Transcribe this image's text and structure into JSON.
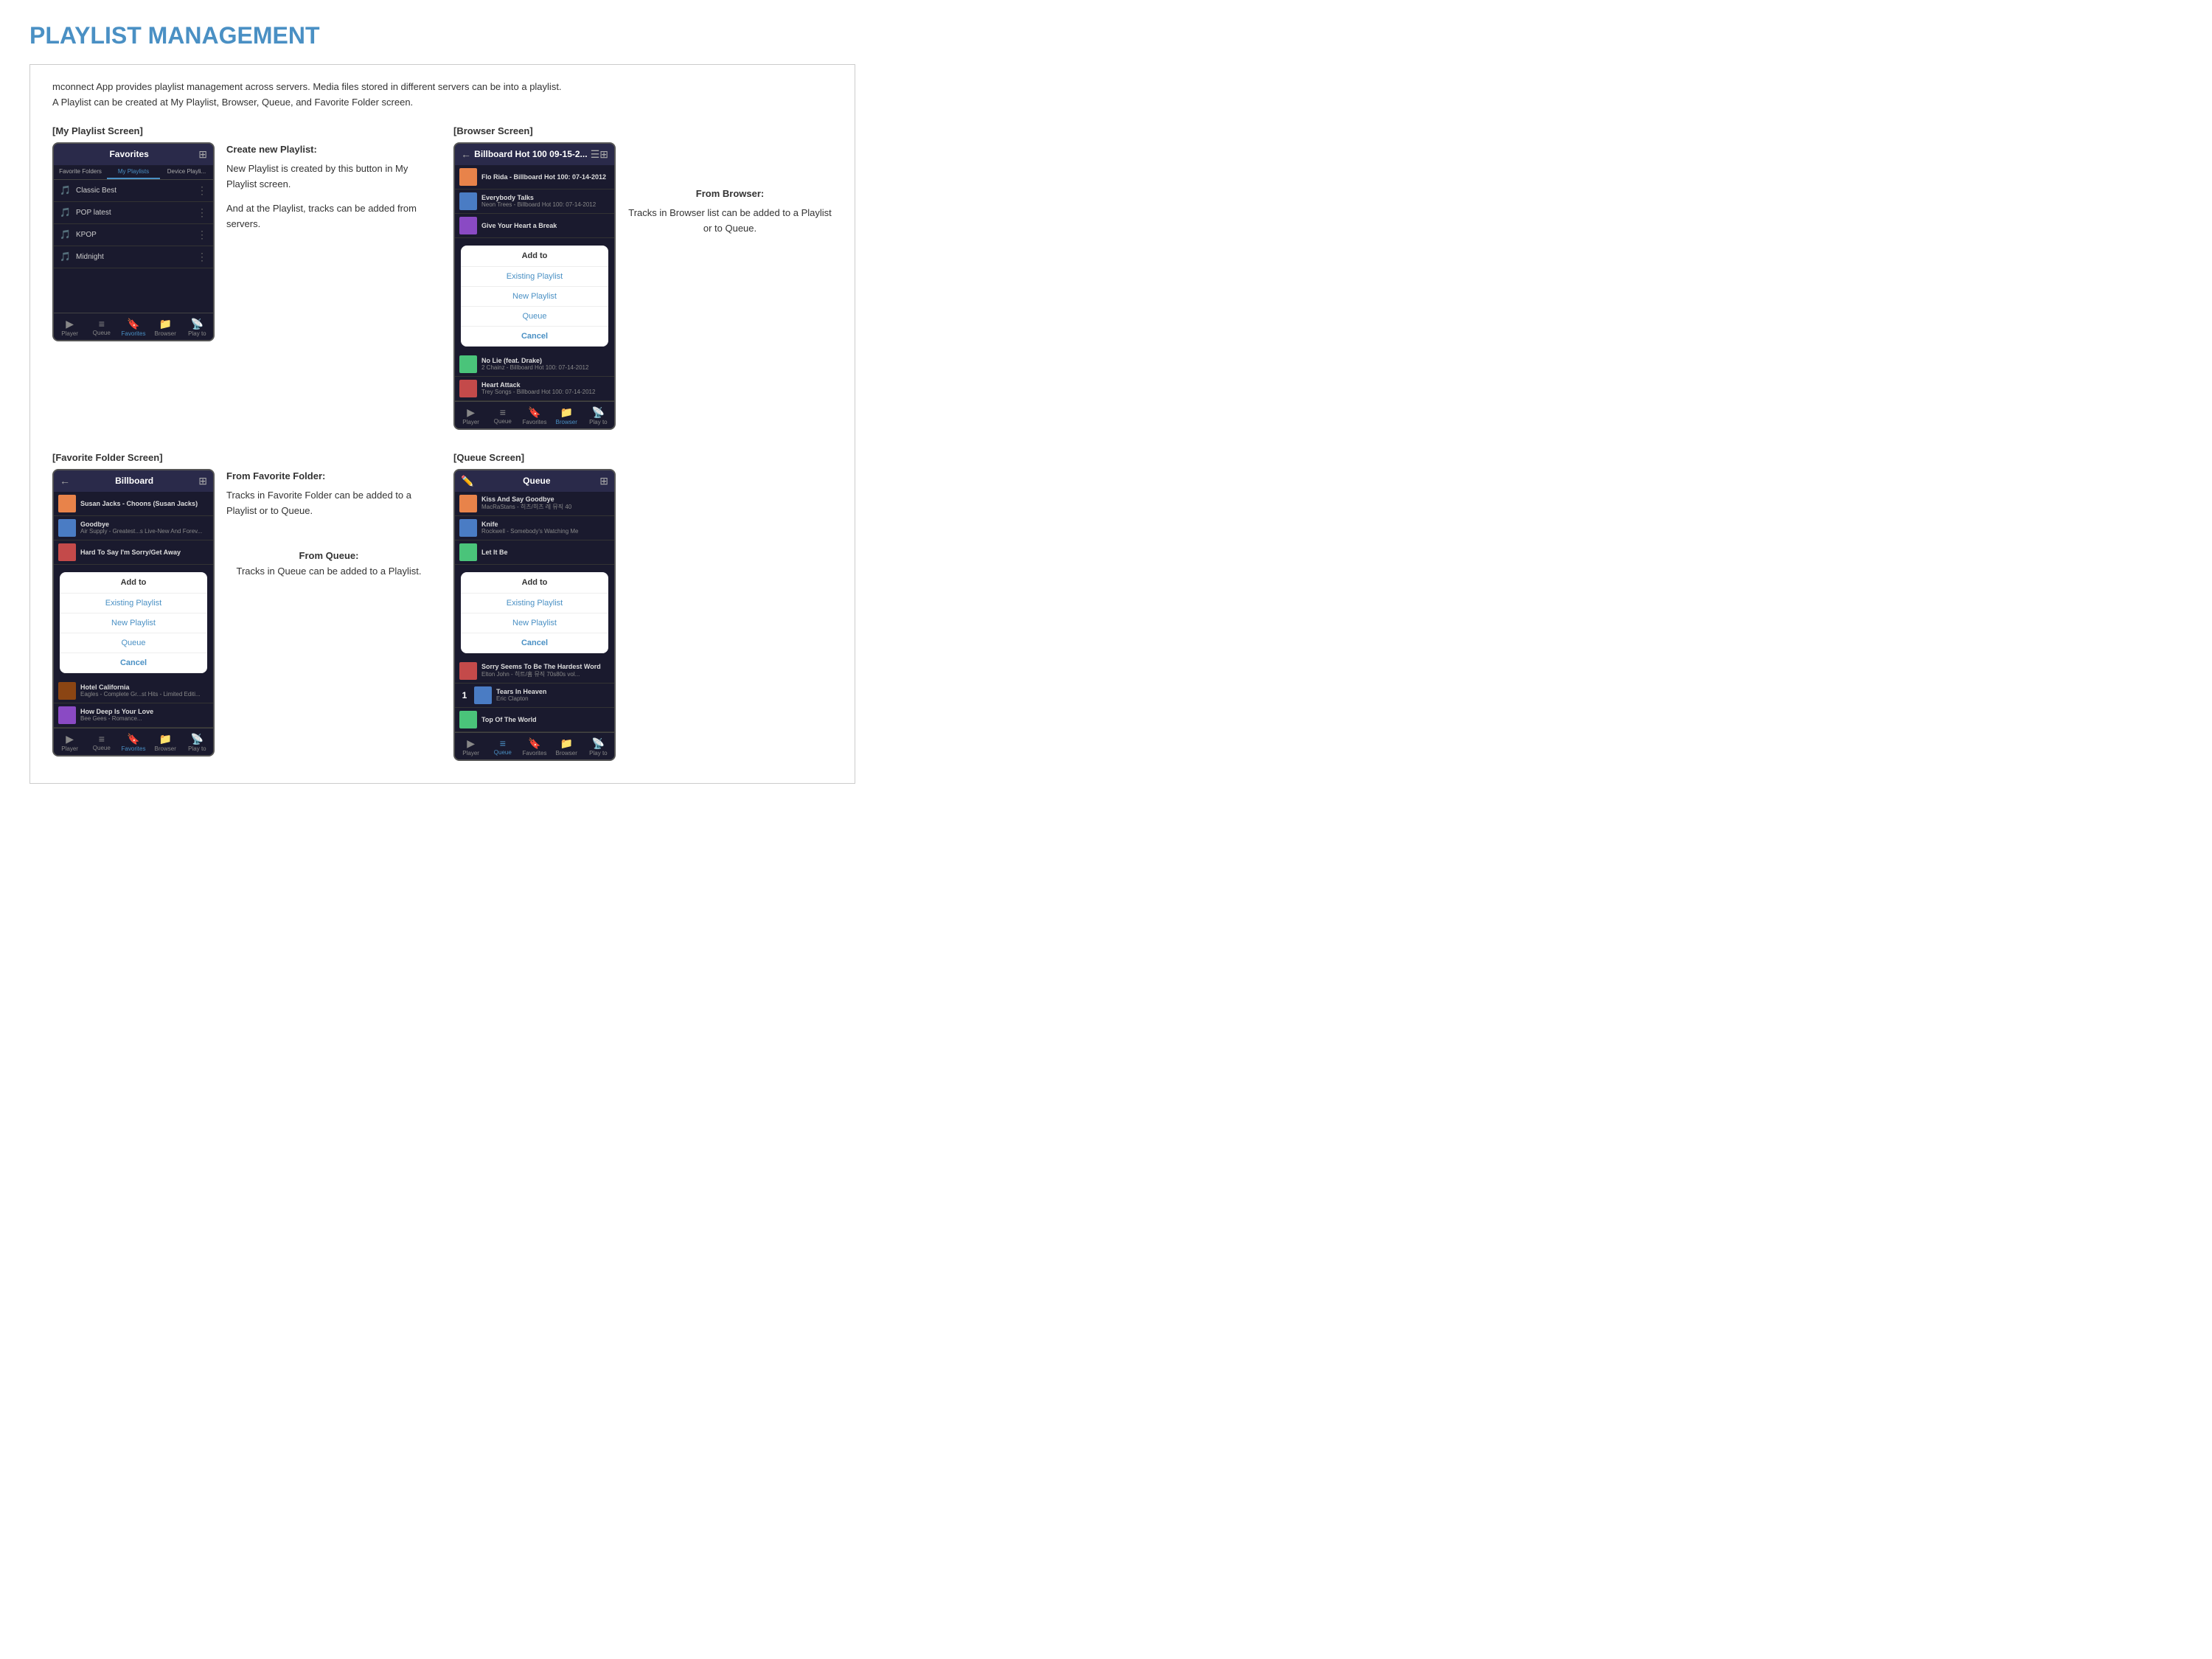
{
  "page": {
    "title": "PLAYLIST MANAGEMENT",
    "intro_line1": "mconnect App provides playlist management across servers. Media files stored in different servers can be into a playlist.",
    "intro_line2": "A Playlist can be created at My Playlist, Browser, Queue, and Favorite Folder screen."
  },
  "sections": {
    "my_playlist": {
      "label": "[My Playlist Screen]",
      "phone": {
        "header_title": "Favorites",
        "tabs": [
          "Favorite Folders",
          "My Playlists",
          "Device Playli..."
        ],
        "active_tab": 1,
        "items": [
          "Classic Best",
          "POP latest",
          "KPOP",
          "Midnight"
        ],
        "footer": [
          "Player",
          "Queue",
          "Favorites",
          "Browser",
          "Play to"
        ],
        "active_footer": 2
      },
      "desc_title": "Create new Playlist:",
      "desc_body": "New Playlist is created by this button in My Playlist screen.\n\nAnd at the Playlist, tracks can be added from servers."
    },
    "browser": {
      "label": "[Browser Screen]",
      "phone": {
        "header_title": "Billboard Hot 100 09-15-2...",
        "tracks": [
          {
            "name": "Flo Rida - Billboard Hot 100: 07-14-2012",
            "color": "orange"
          },
          {
            "name": "Everybody Talks",
            "sub": "Neon Trees - Billboard Hot 100: 07-14-2012",
            "color": "blue"
          },
          {
            "name": "Give Your Heart a Break",
            "sub": "",
            "color": "purple"
          }
        ],
        "modal": {
          "title": "Add to",
          "options": [
            "Existing Playlist",
            "New Playlist",
            "Queue",
            "Cancel"
          ]
        },
        "more_tracks": [
          {
            "name": "No Lie (feat. Drake)",
            "sub": "2 Chainz - Billboard Hot 100: 07-14-2012",
            "color": "green"
          },
          {
            "name": "Heart Attack",
            "sub": "Trey Songs - Billboard Hot 100: 07-14-2012",
            "color": "red"
          }
        ],
        "footer": [
          "Player",
          "Queue",
          "Favorites",
          "Browser",
          "Play to"
        ],
        "active_footer": 3
      },
      "desc_title": "From Browser:",
      "desc_body": "Tracks in Browser list can be added to a Playlist or to Queue."
    },
    "favorite_folder": {
      "label": "[Favorite Folder Screen]",
      "phone": {
        "header_title": "Billboard",
        "tracks": [
          {
            "name": "Susan Jacks - Choons (Susan Jacks)",
            "color": "orange"
          },
          {
            "name": "Goodbye",
            "sub": "Air Supply - Greatest...s Live-New And Forev...",
            "color": "blue"
          },
          {
            "name": "Hard To Say I'm Sorry/Get Away",
            "sub": "",
            "color": "red"
          }
        ],
        "modal": {
          "title": "Add to",
          "options": [
            "Existing Playlist",
            "New Playlist",
            "Queue",
            "Cancel"
          ]
        },
        "more_tracks": [
          {
            "name": "Hotel California",
            "sub": "Eagles - Complete Gr...st Hits - Limited Editi...",
            "color": "brown"
          },
          {
            "name": "How Deep Is Your Love",
            "sub": "Bee Gees - Romance...",
            "color": "purple"
          }
        ],
        "footer": [
          "Player",
          "Queue",
          "Favorites",
          "Browser",
          "Play to"
        ],
        "active_footer": 2
      },
      "desc_title": "From Favorite Folder:",
      "desc_body": "Tracks in Favorite Folder can be added to a Playlist or to Queue."
    },
    "queue": {
      "label": "[Queue Screen]",
      "phone": {
        "header_title": "Queue",
        "tracks": [
          {
            "name": "Kiss And Say Goodbye",
            "sub": "MacRaStans - 히츠/히츠 레 뮤직 40",
            "color": "orange",
            "num": ""
          },
          {
            "name": "Knife",
            "sub": "Rockwell - Somebody's Watching Me",
            "color": "blue",
            "num": ""
          },
          {
            "name": "Let It Be",
            "sub": "",
            "color": "green",
            "num": ""
          }
        ],
        "modal": {
          "title": "Add to",
          "options": [
            "Existing Playlist",
            "New Playlist",
            "Cancel"
          ]
        },
        "more_tracks": [
          {
            "name": "Sorry Seems To Be The Hardest Word",
            "sub": "Elton John - 히트/홈 뮤직 70s80s vol...",
            "color": "red",
            "num": ""
          },
          {
            "name": "Tears In Heaven",
            "sub": "Eric Clapton",
            "color": "blue",
            "num": "1"
          },
          {
            "name": "Top Of The World",
            "sub": "",
            "color": "green",
            "num": ""
          }
        ],
        "footer": [
          "Player",
          "Queue",
          "Favorites",
          "Browser",
          "Play to"
        ],
        "active_footer": 1
      },
      "desc_title": "From Queue:",
      "desc_body": "Tracks in Queue can be added to a Playlist."
    }
  }
}
